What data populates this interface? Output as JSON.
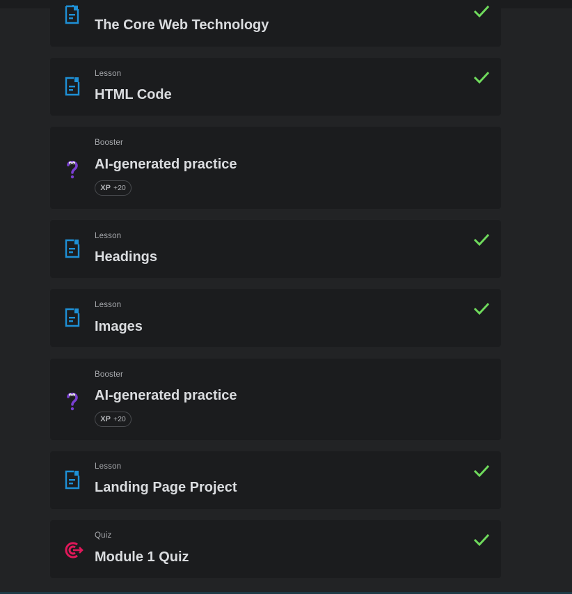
{
  "colors": {
    "background": "#222325",
    "card": "#1b1c1e",
    "lesson_icon": "#1e90d6",
    "booster_icon": "#7a3fd1",
    "quiz_icon": "#e0185a",
    "check": "#6fda5c"
  },
  "items": [
    {
      "type": "",
      "title": "The Core Web Technology",
      "icon": "document-icon",
      "completed": true
    },
    {
      "type": "Lesson",
      "title": "HTML Code",
      "icon": "document-icon",
      "completed": true
    },
    {
      "type": "Booster",
      "title": "AI-generated practice",
      "icon": "question-mark-icon",
      "completed": false,
      "xp_label": "XP",
      "xp_points": "+20"
    },
    {
      "type": "Lesson",
      "title": "Headings",
      "icon": "document-icon",
      "completed": true
    },
    {
      "type": "Lesson",
      "title": "Images",
      "icon": "document-icon",
      "completed": true
    },
    {
      "type": "Booster",
      "title": "AI-generated practice",
      "icon": "question-mark-icon",
      "completed": false,
      "xp_label": "XP",
      "xp_points": "+20"
    },
    {
      "type": "Lesson",
      "title": "Landing Page Project",
      "icon": "document-icon",
      "completed": true
    },
    {
      "type": "Quiz",
      "title": "Module 1 Quiz",
      "icon": "target-icon",
      "completed": true
    }
  ]
}
